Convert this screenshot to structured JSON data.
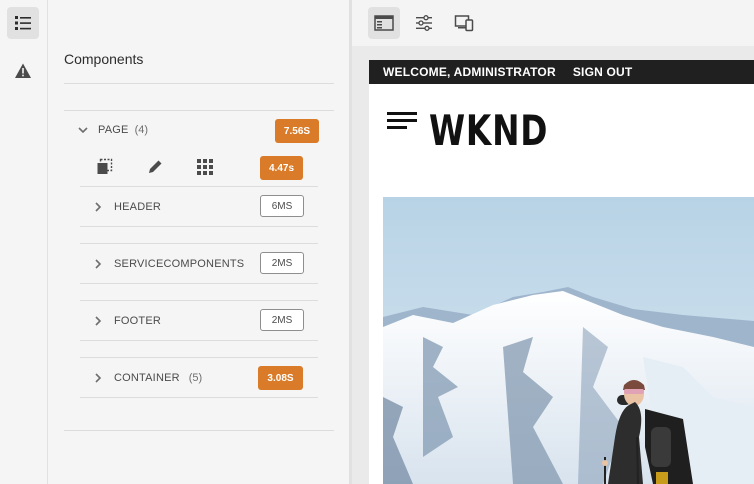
{
  "rail": {
    "items": [
      {
        "icon": "content-tree-icon",
        "active": true
      },
      {
        "icon": "alert-icon",
        "active": false
      }
    ]
  },
  "panel": {
    "title": "Components",
    "page": {
      "label": "PAGE",
      "count": "(4)",
      "time": "7.56S",
      "tools_time": "4.47s"
    },
    "children": [
      {
        "label": "HEADER",
        "count": "",
        "time": "6MS",
        "hot": false
      },
      {
        "label": "SERVICECOMPONENTS",
        "count": "",
        "time": "2MS",
        "hot": false
      },
      {
        "label": "FOOTER",
        "count": "",
        "time": "2MS",
        "hot": false
      },
      {
        "label": "CONTAINER",
        "count": "(5)",
        "time": "3.08S",
        "hot": true
      }
    ]
  },
  "preview": {
    "toolbar": [
      "toggle-side-panel-icon",
      "properties-icon",
      "emulator-icon"
    ],
    "topbar": {
      "welcome": "WELCOME, ADMINISTRATOR",
      "signout": "SIGN OUT"
    },
    "brand": "WKND"
  },
  "colors": {
    "hot": "#d97b28",
    "topbar": "#202020"
  }
}
